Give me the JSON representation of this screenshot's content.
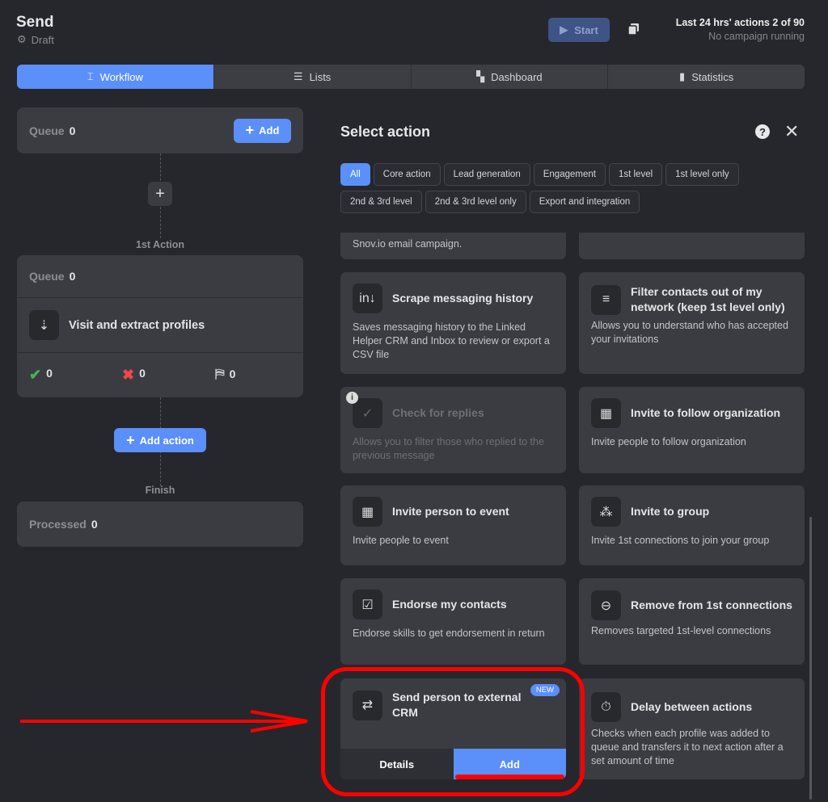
{
  "header": {
    "title": "Send",
    "status": "Draft",
    "start_label": "Start",
    "actions_label": "Last 24 hrs' actions 2 of 90",
    "campaign_status": "No campaign running"
  },
  "tabs": [
    {
      "label": "Workflow",
      "icon": "workflow-icon",
      "active": true
    },
    {
      "label": "Lists",
      "icon": "list-icon"
    },
    {
      "label": "Dashboard",
      "icon": "dashboard-icon"
    },
    {
      "label": "Statistics",
      "icon": "bar-chart-icon"
    }
  ],
  "workflow": {
    "queue_label": "Queue",
    "queue_value": "0",
    "add_label": "Add",
    "step1_label": "1st Action",
    "action_queue_label": "Queue",
    "action_queue_value": "0",
    "action_name": "Visit and extract profiles",
    "success": "0",
    "failed": "0",
    "skipped": "0",
    "add_action_label": "Add action",
    "finish_label": "Finish",
    "processed_label": "Processed",
    "processed_value": "0"
  },
  "panel": {
    "title": "Select action",
    "filters": [
      "All",
      "Core action",
      "Lead generation",
      "Engagement",
      "1st level",
      "1st level only",
      "2nd & 3rd level",
      "2nd & 3rd level only",
      "Export and integration"
    ],
    "cards": [
      {
        "name": "",
        "desc": "Snov.io email campaign.",
        "icon": ""
      },
      {
        "name": "",
        "desc": "",
        "icon": ""
      },
      {
        "name": "Scrape messaging history",
        "desc": "Saves messaging history to the Linked Helper CRM and Inbox to review or export a CSV file",
        "icon": "linkedin-download-icon"
      },
      {
        "name": "Filter contacts out of my network (keep 1st level only)",
        "desc": "Allows you to understand who has accepted your invitations",
        "icon": "filter-icon"
      },
      {
        "name": "Check for replies",
        "desc": "Allows you to filter those who replied to the previous message",
        "icon": "chat-check-icon",
        "disabled": true
      },
      {
        "name": "Invite to follow organization",
        "desc": "Invite people to follow organization",
        "icon": "building-plus-icon"
      },
      {
        "name": "Invite person to event",
        "desc": "Invite people to event",
        "icon": "calendar-icon"
      },
      {
        "name": "Invite to group",
        "desc": "Invite 1st connections to join your group",
        "icon": "group-plus-icon"
      },
      {
        "name": "Endorse my contacts",
        "desc": "Endorse skills to get endorsement in return",
        "icon": "clipboard-check-icon"
      },
      {
        "name": "Remove from 1st connections",
        "desc": "Removes targeted 1st-level connections",
        "icon": "person-remove-icon"
      },
      {
        "name": "Send person to external CRM",
        "desc": "",
        "icon": "person-export-icon",
        "badge": "NEW",
        "details_label": "Details",
        "add_label": "Add"
      },
      {
        "name": "Delay between actions",
        "desc": "Checks when each profile was added to queue and transfers it to next action after a set amount of time",
        "icon": "stopwatch-icon"
      }
    ]
  },
  "colors": {
    "accent": "#5b8ff9",
    "background": "#26272c",
    "card": "#3b3c42",
    "annotation": "#ff0000"
  }
}
